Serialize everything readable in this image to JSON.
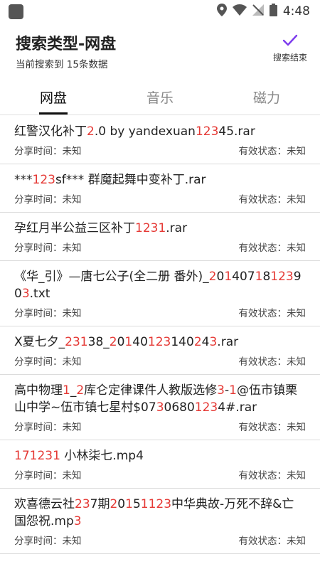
{
  "status_bar": {
    "time": "4:48"
  },
  "app_bar": {
    "title": "搜索类型-网盘",
    "subtitle": "当前搜索到 15条数据",
    "end_button_label": "搜索结束",
    "accent": "#7c3aed"
  },
  "tabs": [
    {
      "label": "网盘",
      "active": true
    },
    {
      "label": "音乐",
      "active": false
    },
    {
      "label": "磁力",
      "active": false
    }
  ],
  "highlight_color": "#e53935",
  "results": [
    {
      "title": [
        [
          "红警汉化补丁",
          false
        ],
        [
          "2",
          true
        ],
        [
          ".0 by yandexuan",
          false
        ],
        [
          "123",
          true
        ],
        [
          "45.rar",
          false
        ]
      ],
      "share_time": "分享时间：未知",
      "status": "有效状态：未知"
    },
    {
      "title": [
        [
          "***",
          false
        ],
        [
          "123",
          true
        ],
        [
          "sf*** 群魔起舞中变补丁.rar",
          false
        ]
      ],
      "share_time": "分享时间：未知",
      "status": "有效状态：未知"
    },
    {
      "title": [
        [
          "孕红月半公益三区补丁",
          false
        ],
        [
          "1231",
          true
        ],
        [
          ".rar",
          false
        ]
      ],
      "share_time": "分享时间：未知",
      "status": "有效状态：未知"
    },
    {
      "title": [
        [
          "《华_引》—唐七公子(全二册 番外)_",
          false
        ],
        [
          "2",
          true
        ],
        [
          "0",
          false
        ],
        [
          "1",
          true
        ],
        [
          "4",
          false
        ],
        [
          "07",
          false
        ],
        [
          "1",
          true
        ],
        [
          "8",
          false
        ],
        [
          "123",
          true
        ],
        [
          "90",
          false
        ],
        [
          "3",
          true
        ],
        [
          ".txt",
          false
        ]
      ],
      "share_time": "分享时间：未知",
      "status": "有效状态：未知"
    },
    {
      "title": [
        [
          "X夏七夕_",
          false
        ],
        [
          "231",
          true
        ],
        [
          "3",
          false
        ],
        [
          "8_",
          false
        ],
        [
          "2",
          true
        ],
        [
          "0",
          false
        ],
        [
          "1",
          true
        ],
        [
          "40",
          false
        ],
        [
          "123",
          true
        ],
        [
          "1",
          false
        ],
        [
          "40",
          false
        ],
        [
          "2",
          true
        ],
        [
          "4",
          false
        ],
        [
          "3",
          true
        ],
        [
          ".rar",
          false
        ]
      ],
      "share_time": "分享时间：未知",
      "status": "有效状态：未知"
    },
    {
      "title": [
        [
          "高中物理",
          false
        ],
        [
          "1",
          true
        ],
        [
          "_",
          false
        ],
        [
          "2",
          true
        ],
        [
          "库仑定律课件人教版选修",
          false
        ],
        [
          "3",
          true
        ],
        [
          "-",
          false
        ],
        [
          "1",
          true
        ],
        [
          "@伍市镇栗山中学~伍市镇七星村$07",
          false
        ],
        [
          "3",
          true
        ],
        [
          "0680",
          false
        ],
        [
          "123",
          true
        ],
        [
          "4#.rar",
          false
        ]
      ],
      "share_time": "分享时间：未知",
      "status": "有效状态：未知"
    },
    {
      "title": [
        [
          "171231",
          true
        ],
        [
          " 小林柒七.mp4",
          false
        ]
      ],
      "share_time": "分享时间：未知",
      "status": "有效状态：未知"
    },
    {
      "title": [
        [
          "欢喜德云社",
          false
        ],
        [
          "23",
          true
        ],
        [
          "7期",
          false
        ],
        [
          "2",
          true
        ],
        [
          "0",
          false
        ],
        [
          "1",
          true
        ],
        [
          "5",
          false
        ],
        [
          "1123",
          true
        ],
        [
          "中华典故-万死不辞&亡国怨祝.mp",
          false
        ],
        [
          "3",
          true
        ]
      ],
      "share_time": "分享时间：未知",
      "status": "有效状态：未知"
    }
  ]
}
